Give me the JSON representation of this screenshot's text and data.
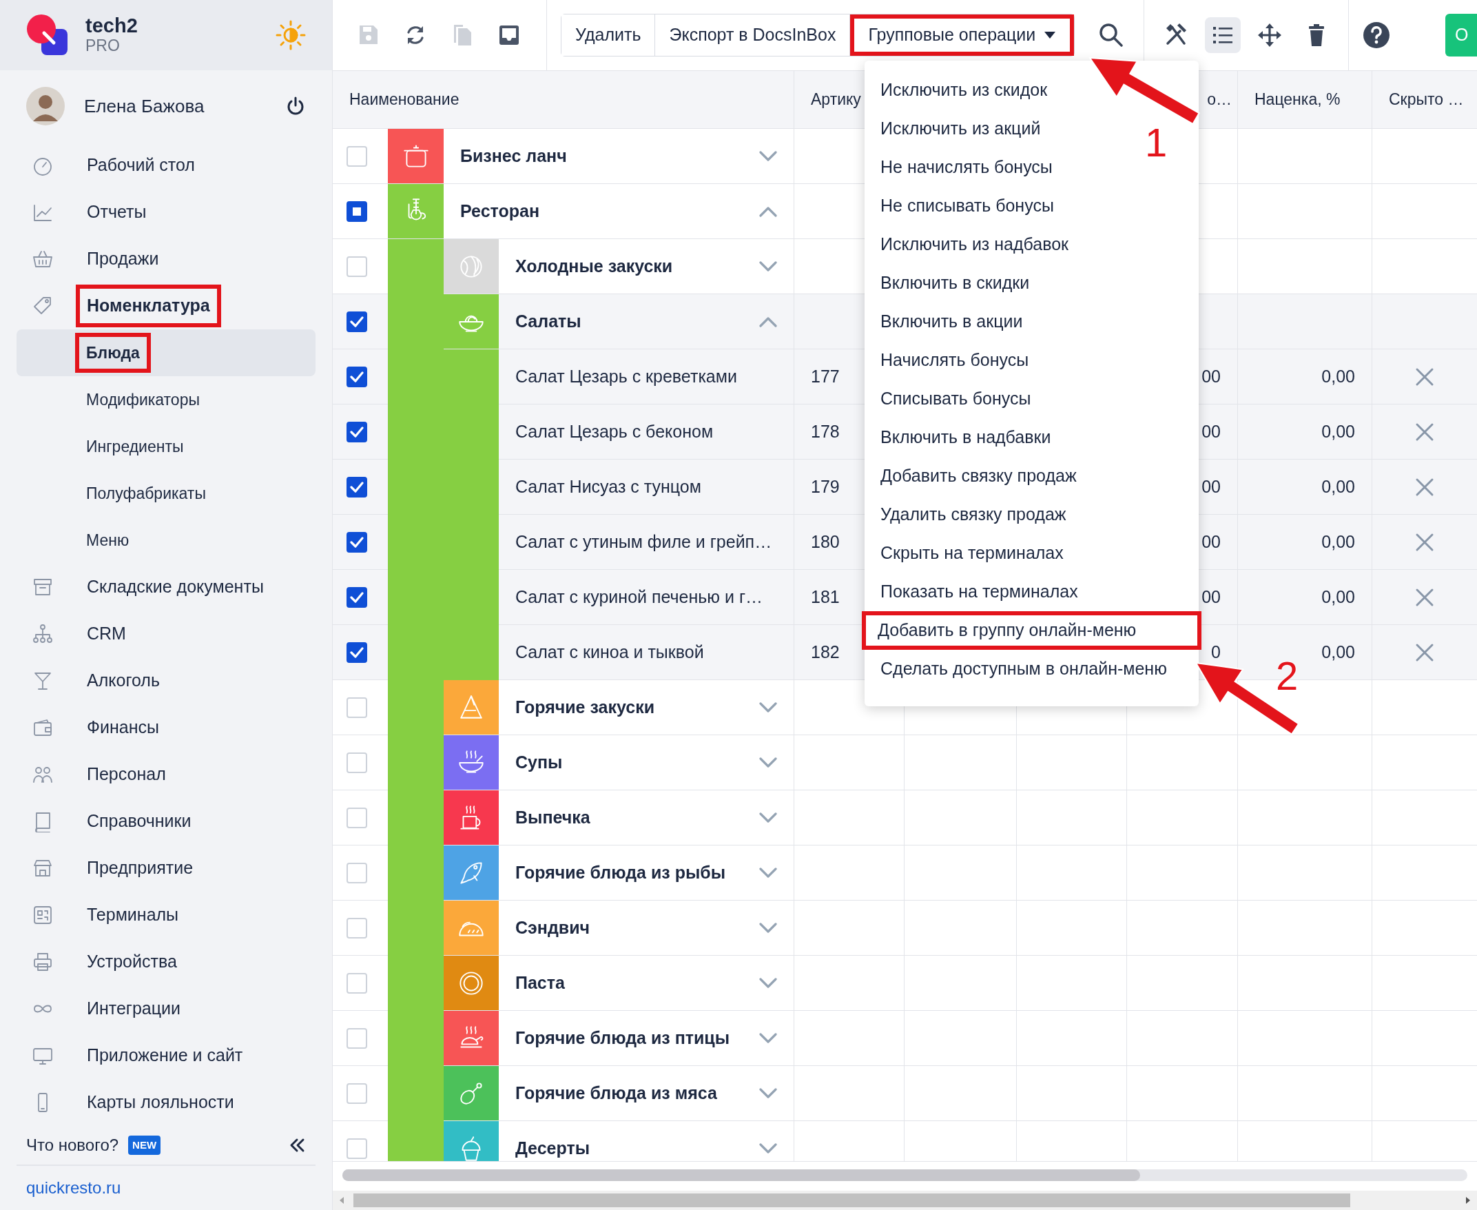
{
  "sidebar": {
    "brand": {
      "name": "tech2",
      "plan": "PRO"
    },
    "user": {
      "name": "Елена Бажова"
    },
    "items": [
      {
        "label": "Рабочий стол",
        "selected": false,
        "highlighted": false
      },
      {
        "label": "Отчеты",
        "selected": false,
        "highlighted": false
      },
      {
        "label": "Продажи",
        "selected": false,
        "highlighted": false
      },
      {
        "label": "Номенклатура",
        "selected": true,
        "highlighted": true,
        "children": [
          {
            "label": "Блюда",
            "selected": true,
            "highlighted": true
          },
          {
            "label": "Модификаторы",
            "selected": false,
            "highlighted": false
          },
          {
            "label": "Ингредиенты",
            "selected": false,
            "highlighted": false
          },
          {
            "label": "Полуфабрикаты",
            "selected": false,
            "highlighted": false
          },
          {
            "label": "Меню",
            "selected": false,
            "highlighted": false
          }
        ]
      },
      {
        "label": "Складские документы",
        "selected": false,
        "highlighted": false
      },
      {
        "label": "CRM",
        "selected": false,
        "highlighted": false
      },
      {
        "label": "Алкоголь",
        "selected": false,
        "highlighted": false
      },
      {
        "label": "Финансы",
        "selected": false,
        "highlighted": false
      },
      {
        "label": "Персонал",
        "selected": false,
        "highlighted": false
      },
      {
        "label": "Справочники",
        "selected": false,
        "highlighted": false
      },
      {
        "label": "Предприятие",
        "selected": false,
        "highlighted": false
      },
      {
        "label": "Терминалы",
        "selected": false,
        "highlighted": false
      },
      {
        "label": "Устройства",
        "selected": false,
        "highlighted": false
      },
      {
        "label": "Интеграции",
        "selected": false,
        "highlighted": false
      },
      {
        "label": "Приложение и сайт",
        "selected": false,
        "highlighted": false
      },
      {
        "label": "Карты лояльности",
        "selected": false,
        "highlighted": false
      }
    ],
    "whats_new": {
      "label": "Что нового?",
      "badge": "NEW"
    },
    "site_link": "quickresto.ru"
  },
  "toolbar": {
    "actions": [
      {
        "disabled": true
      },
      {
        "disabled": false
      },
      {
        "disabled": true
      },
      {
        "disabled": false
      }
    ],
    "buttons": [
      {
        "label": "Удалить",
        "highlighted": false,
        "dropdown": false
      },
      {
        "label": "Экспорт в DocsInBox",
        "highlighted": false,
        "dropdown": false
      },
      {
        "label": "Групповые операции",
        "highlighted": true,
        "dropdown": true
      }
    ],
    "view_tools": [
      {
        "selected": false
      },
      {
        "selected": true
      },
      {
        "selected": false
      },
      {
        "selected": false
      }
    ],
    "primary_button": "О"
  },
  "table": {
    "columns": [
      "Наименование",
      "Артику",
      "о…",
      "Наценка, %",
      "Скрыто …"
    ],
    "rows": [
      {
        "name": "Бизнес ланч",
        "kind": "group",
        "checked": false,
        "indeterminate": false,
        "expanded": false,
        "color": "#f75555"
      },
      {
        "name": "Ресторан",
        "kind": "group",
        "checked": true,
        "indeterminate": true,
        "expanded": true,
        "color": "#86cf42",
        "children": [
          {
            "name": "Холодные закуски",
            "kind": "group",
            "checked": false,
            "indeterminate": false,
            "expanded": false,
            "color": "#dadada"
          },
          {
            "name": "Салаты",
            "kind": "group",
            "checked": true,
            "indeterminate": false,
            "expanded": true,
            "color": "#86cf42",
            "children": [
              {
                "name": "Салат Цезарь с креветками",
                "kind": "item",
                "checked": true,
                "indeterminate": false,
                "article": "177",
                "column_4": "00",
                "markup": "0,00",
                "hidden": false
              },
              {
                "name": "Салат Цезарь с беконом",
                "kind": "item",
                "checked": true,
                "indeterminate": false,
                "article": "178",
                "column_4": "00",
                "markup": "0,00",
                "hidden": false
              },
              {
                "name": "Салат Нисуаз с тунцом",
                "kind": "item",
                "checked": true,
                "indeterminate": false,
                "article": "179",
                "column_4": "00",
                "markup": "0,00",
                "hidden": false
              },
              {
                "name": "Салат с утиным филе и грейп…",
                "kind": "item",
                "checked": true,
                "indeterminate": false,
                "article": "180",
                "column_4": "00",
                "markup": "0,00",
                "hidden": false
              },
              {
                "name": "Салат с куриной печенью и г…",
                "kind": "item",
                "checked": true,
                "indeterminate": false,
                "article": "181",
                "column_4": "00",
                "markup": "0,00",
                "hidden": false
              },
              {
                "name": "Салат с киноа и тыквой",
                "kind": "item",
                "checked": true,
                "indeterminate": false,
                "article": "182",
                "column_4": "0",
                "markup": "0,00",
                "hidden": false
              }
            ]
          },
          {
            "name": "Горячие закуски",
            "kind": "group",
            "checked": false,
            "indeterminate": false,
            "expanded": false,
            "color": "#fba83a"
          },
          {
            "name": "Супы",
            "kind": "group",
            "checked": false,
            "indeterminate": false,
            "expanded": false,
            "color": "#7b6ef2"
          },
          {
            "name": "Выпечка",
            "kind": "group",
            "checked": false,
            "indeterminate": false,
            "expanded": false,
            "color": "#f7384e"
          },
          {
            "name": "Горячие блюда из рыбы",
            "kind": "group",
            "checked": false,
            "indeterminate": false,
            "expanded": false,
            "color": "#4ea3e5"
          },
          {
            "name": "Сэндвич",
            "kind": "group",
            "checked": false,
            "indeterminate": false,
            "expanded": false,
            "color": "#fba83a"
          },
          {
            "name": "Паста",
            "kind": "group",
            "checked": false,
            "indeterminate": false,
            "expanded": false,
            "color": "#e08a12"
          },
          {
            "name": "Горячие блюда из птицы",
            "kind": "group",
            "checked": false,
            "indeterminate": false,
            "expanded": false,
            "color": "#f75555"
          },
          {
            "name": "Горячие блюда из мяса",
            "kind": "group",
            "checked": false,
            "indeterminate": false,
            "expanded": false,
            "color": "#4cc15a"
          },
          {
            "name": "Десерты",
            "kind": "group",
            "checked": false,
            "indeterminate": false,
            "expanded": false,
            "color": "#32bdc5"
          }
        ]
      }
    ]
  },
  "group_operations_menu": {
    "items": [
      {
        "label": "Исключить из скидок",
        "highlighted": false
      },
      {
        "label": "Исключить из акций",
        "highlighted": false
      },
      {
        "label": "Не начислять бонусы",
        "highlighted": false
      },
      {
        "label": "Не списывать бонусы",
        "highlighted": false
      },
      {
        "label": "Исключить из надбавок",
        "highlighted": false
      },
      {
        "label": "Включить в скидки",
        "highlighted": false
      },
      {
        "label": "Включить в акции",
        "highlighted": false
      },
      {
        "label": "Начислять бонусы",
        "highlighted": false
      },
      {
        "label": "Списывать бонусы",
        "highlighted": false
      },
      {
        "label": "Включить в надбавки",
        "highlighted": false
      },
      {
        "label": "Добавить связку продаж",
        "highlighted": false
      },
      {
        "label": "Удалить связку продаж",
        "highlighted": false
      },
      {
        "label": "Скрыть на терминалах",
        "highlighted": false
      },
      {
        "label": "Показать на терминалах",
        "highlighted": false
      },
      {
        "label": "Добавить в группу онлайн-меню",
        "highlighted": true
      },
      {
        "label": "Сделать доступным в онлайн-меню",
        "highlighted": false
      }
    ]
  },
  "annotations": [
    {
      "label": "1"
    },
    {
      "label": "2"
    }
  ]
}
